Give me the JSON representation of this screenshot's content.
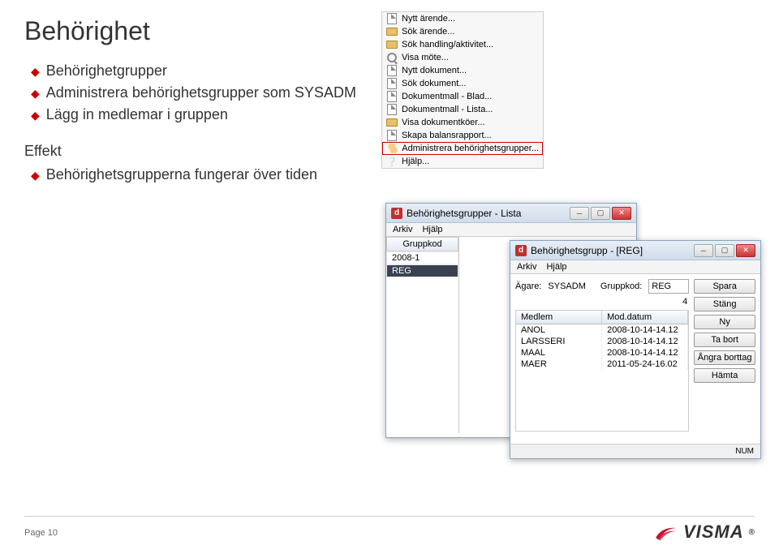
{
  "title": "Behörighet",
  "bullets": [
    "Behörighetgrupper",
    "Administrera behörighetsgrupper som SYSADM",
    "Lägg in medlemar i gruppen"
  ],
  "subheading": "Effekt",
  "sub_bullets": [
    "Behörighetsgrupperna fungerar över tiden"
  ],
  "context_menu": {
    "items": [
      "Nytt ärende...",
      "Sök ärende...",
      "Sök handling/aktivitet...",
      "Visa möte...",
      "Nytt dokument...",
      "Sök dokument...",
      "Dokumentmall - Blad...",
      "Dokumentmall - Lista...",
      "Visa dokumentköer...",
      "Skapa balansrapport...",
      "Administrera behörighetsgrupper...",
      "Hjälp..."
    ],
    "highlighted_index": 10
  },
  "list_window": {
    "title": "Behörighetsgrupper - Lista",
    "menubar": [
      "Arkiv",
      "Hjälp"
    ],
    "column_header": "Gruppkod",
    "rows": [
      "2008-1",
      "REG"
    ],
    "selected_index": 1
  },
  "detail_window": {
    "title": "Behörighetsgrupp - [REG]",
    "menubar": [
      "Arkiv",
      "Hjälp"
    ],
    "owner_label": "Ägare:",
    "owner_value": "SYSADM",
    "code_label": "Gruppkod:",
    "code_value": "REG",
    "count": "4",
    "columns": [
      "Medlem",
      "Mod.datum"
    ],
    "members": [
      {
        "name": "ANOL",
        "date": "2008-10-14-14.12"
      },
      {
        "name": "LARSSERI",
        "date": "2008-10-14-14.12"
      },
      {
        "name": "MAAL",
        "date": "2008-10-14-14.12"
      },
      {
        "name": "MAER",
        "date": "2011-05-24-16.02"
      }
    ],
    "buttons": [
      "Spara",
      "Stäng",
      "Ny",
      "Ta bort",
      "Ångra borttag",
      "Hämta"
    ],
    "statusbar": "NUM"
  },
  "footer": {
    "page": "Page 10",
    "brand": "VISMA"
  }
}
